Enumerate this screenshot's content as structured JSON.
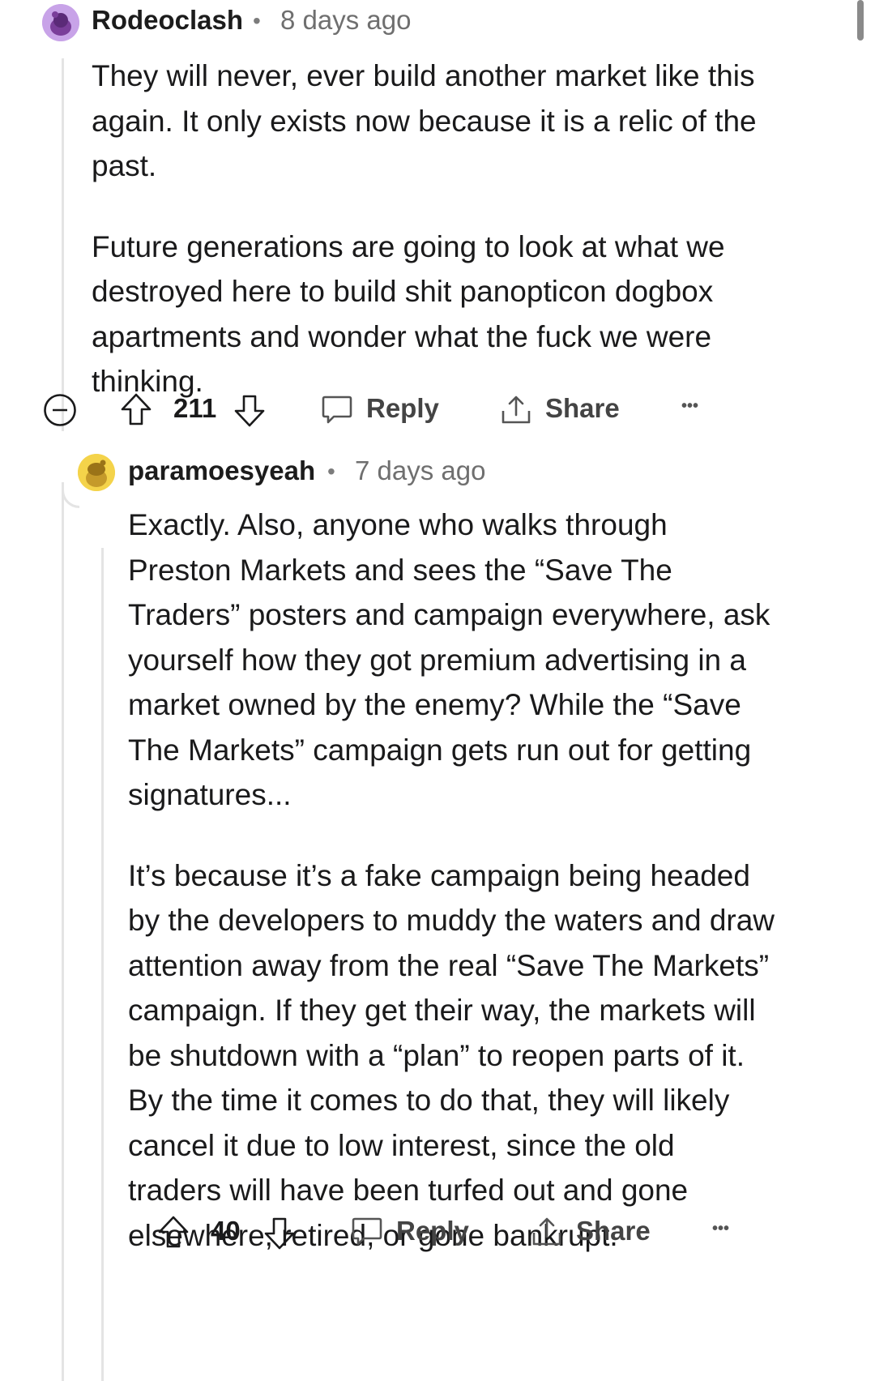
{
  "comments": [
    {
      "username": "Rodeoclash",
      "separator": "•",
      "time": "8 days ago",
      "paragraphs": [
        "They will never, ever build another market like this again. It only exists now because it is a relic of the past.",
        "Future generations are going to look at what we destroyed here to build shit panopticon dogbox apartments and wonder what the fuck we were thinking."
      ],
      "vote_count": "211",
      "reply_label": "Reply",
      "share_label": "Share",
      "more_label": "•••"
    },
    {
      "username": "paramoesyeah",
      "separator": "•",
      "time": "7 days ago",
      "paragraphs": [
        "Exactly. Also, anyone who walks through Preston Markets and sees the “Save The Traders” posters and campaign everywhere, ask yourself how they got premium advertising in a market owned by the enemy? While the “Save The Markets” campaign gets run out for getting signatures...",
        "It’s because it’s a fake campaign being headed by the developers to muddy the waters and draw attention away from the real “Save The Markets” campaign. If they get their way, the markets will be shutdown with a “plan” to reopen parts of it. By the time it comes to do that, they will likely cancel it due to low interest, since the old traders will have been turfed out and gone elsewhere, retired, or gone bankrupt."
      ],
      "vote_count": "40",
      "reply_label": "Reply",
      "share_label": "Share",
      "more_label": "•••"
    }
  ],
  "icons": {
    "collapse": "collapse-minus-icon",
    "upvote": "upvote-arrow-icon",
    "downvote": "downvote-arrow-icon",
    "reply": "speech-bubble-icon",
    "share": "share-upload-icon",
    "more": "more-dots-icon"
  },
  "colors": {
    "avatar_1_bg": "#c8a3e8",
    "avatar_2_bg": "#f4d34a",
    "thread_line": "#e4e4e4",
    "meta_text": "#6f6f6f"
  }
}
